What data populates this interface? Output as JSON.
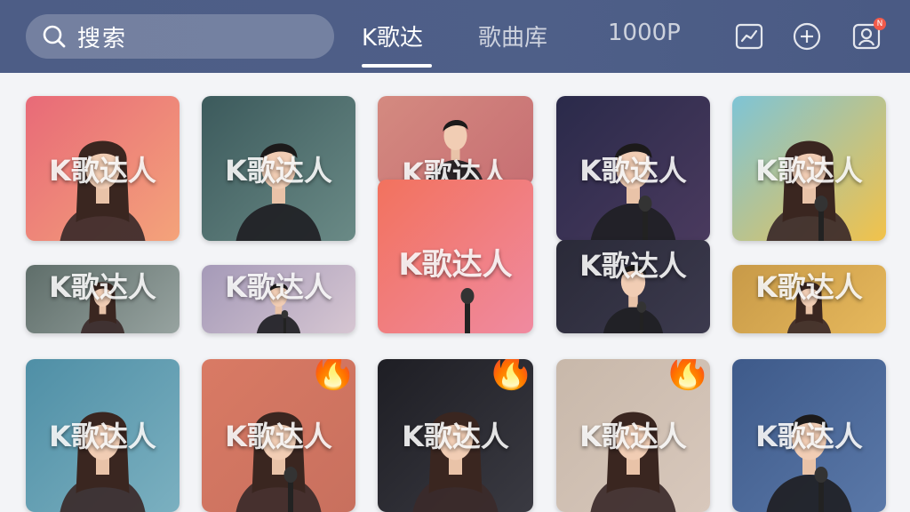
{
  "header": {
    "search_placeholder": "搜索",
    "tabs": [
      {
        "label": "K歌达",
        "active": true
      },
      {
        "label": "歌曲库",
        "active": false
      },
      {
        "label": "1000P",
        "active": false
      }
    ],
    "icons": [
      "chart-icon",
      "add-circle-icon",
      "profile-icon"
    ],
    "profile_badge": "N"
  },
  "cards": [
    {
      "label": "K歌达人",
      "bg": [
        "#e86a78",
        "#f4a37a"
      ],
      "person": "woman",
      "hot": false
    },
    {
      "label": "K歌达人",
      "bg": [
        "#3c5a5c",
        "#6a8a86"
      ],
      "person": "man",
      "hot": false
    },
    {
      "label": "K歌达人",
      "bg": [
        "#d48a80",
        "#c76f73"
      ],
      "person": "man",
      "hot": false
    },
    {
      "label": "K歌达人",
      "bg": [
        "#2a2a4a",
        "#4a3a5e"
      ],
      "person": "man-mic",
      "hot": false
    },
    {
      "label": "K歌达人",
      "bg": [
        "#7ec4d6",
        "#f2c24a"
      ],
      "person": "woman-mic",
      "hot": false
    },
    {
      "label": "K歌达人",
      "bg": [
        "#5f6e6a",
        "#97a3a0"
      ],
      "person": "woman",
      "hot": false
    },
    {
      "label": "K歌达人",
      "bg": [
        "#a59ab8",
        "#d6c6d2"
      ],
      "person": "man-mic",
      "hot": false
    },
    {
      "label": "K歌达人",
      "bg": [
        "#f2725e",
        "#f08aa0"
      ],
      "person": "mic",
      "hot": false
    },
    {
      "label": "K歌达人",
      "bg": [
        "#2a2a38",
        "#3c3a4e"
      ],
      "person": "man-mic",
      "hot": false
    },
    {
      "label": "K歌达人",
      "bg": [
        "#c89a48",
        "#e6b85c"
      ],
      "person": "woman",
      "hot": false
    },
    {
      "label": "K歌达人",
      "bg": [
        "#4f8fa6",
        "#7bb0c0"
      ],
      "person": "woman",
      "hot": false
    },
    {
      "label": "K歌达人",
      "bg": [
        "#d97a64",
        "#c8705e"
      ],
      "person": "woman-mic",
      "hot": true
    },
    {
      "label": "K歌达人",
      "bg": [
        "#1e1e24",
        "#3a3a42"
      ],
      "person": "woman",
      "hot": true
    },
    {
      "label": "K歌达人",
      "bg": [
        "#c8b8aa",
        "#d8c8bc"
      ],
      "person": "woman",
      "hot": true
    },
    {
      "label": "K歌达人",
      "bg": [
        "#3e5a8a",
        "#5a78a8"
      ],
      "person": "man-mic",
      "hot": false
    }
  ],
  "hot_icon": "fire-icon"
}
